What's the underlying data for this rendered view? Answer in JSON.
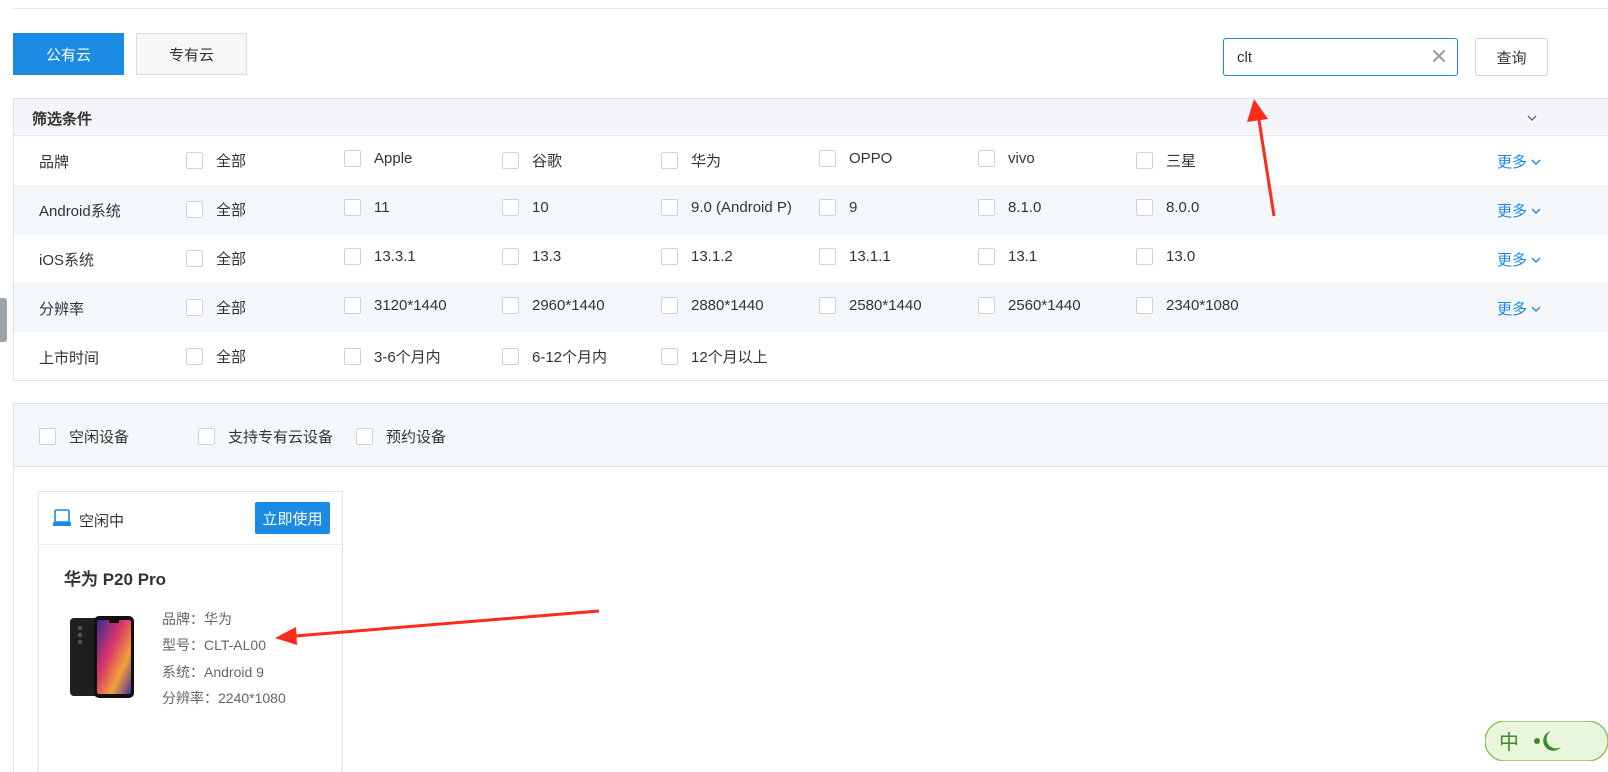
{
  "tabs": {
    "public": "公有云",
    "private": "专有云"
  },
  "search": {
    "value": "clt",
    "button": "查询"
  },
  "filters": {
    "title": "筛选条件",
    "more": "更多",
    "rows": [
      {
        "label": "品牌",
        "options": [
          "全部",
          "Apple",
          "谷歌",
          "华为",
          "OPPO",
          "vivo",
          "三星"
        ]
      },
      {
        "label": "Android系统",
        "options": [
          "全部",
          "11",
          "10",
          "9.0 (Android P)",
          "9",
          "8.1.0",
          "8.0.0"
        ]
      },
      {
        "label": "iOS系统",
        "options": [
          "全部",
          "13.3.1",
          "13.3",
          "13.1.2",
          "13.1.1",
          "13.1",
          "13.0"
        ]
      },
      {
        "label": "分辨率",
        "options": [
          "全部",
          "3120*1440",
          "2960*1440",
          "2880*1440",
          "2580*1440",
          "2560*1440",
          "2340*1080"
        ]
      },
      {
        "label": "上市时间",
        "options": [
          "全部",
          "3-6个月内",
          "6-12个月内",
          "12个月以上"
        ]
      }
    ]
  },
  "device_filters": [
    "空闲设备",
    "支持专有云设备",
    "预约设备"
  ],
  "device_card": {
    "status": "空闲中",
    "use_button": "立即使用",
    "name": "华为 P20 Pro",
    "brand": "品牌：华为",
    "model": "型号：CLT-AL00",
    "system": "系统：Android 9",
    "resolution": "分辨率：2240*1080"
  },
  "colors": {
    "primary": "#1a8ae3",
    "annotation_arrow": "#ff2a1a"
  },
  "badge": {
    "text": "中"
  }
}
